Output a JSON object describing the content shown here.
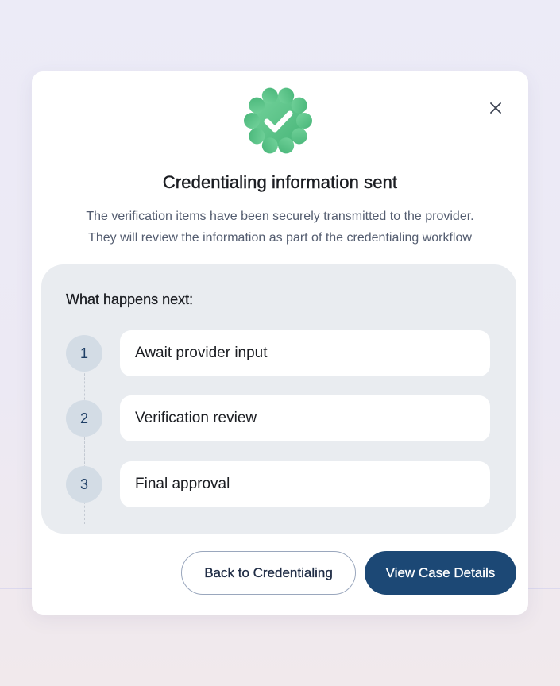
{
  "dialog": {
    "title": "Credentialing information sent",
    "description_line1": "The verification items have been securely transmitted to the provider.",
    "description_line2": "They will review the information as part of the credentialing workflow",
    "status_icon": "verified-badge-icon",
    "close_icon": "close-icon"
  },
  "next_steps": {
    "heading": "What happens next:",
    "steps": [
      {
        "number": "1",
        "label": "Await provider input"
      },
      {
        "number": "2",
        "label": "Verification review"
      },
      {
        "number": "3",
        "label": "Final approval"
      }
    ]
  },
  "actions": {
    "secondary_label": "Back to Credentialing",
    "primary_label": "View Case Details"
  },
  "colors": {
    "primary": "#1c4875",
    "success": "#5cc489",
    "panel": "#e9ecf0",
    "step_circle": "#d3dce5"
  }
}
